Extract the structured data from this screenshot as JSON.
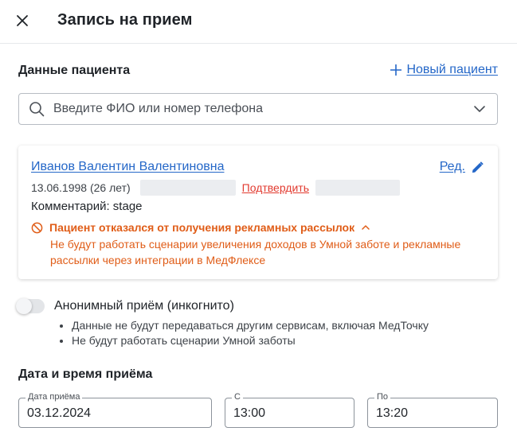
{
  "header": {
    "title": "Запись на прием"
  },
  "patient_section": {
    "title": "Данные пациента",
    "new_patient_label": "Новый пациент",
    "search_placeholder": "Введите ФИО или номер телефона"
  },
  "patient_card": {
    "name": "Иванов Валентин Валентиновна",
    "edit_label": "Ред.",
    "birth_info": "13.06.1998 (26 лет)",
    "confirm_label": "Подтвердить",
    "comment": "Комментарий: stage",
    "warning_title": "Пациент отказался от получения рекламных рассылок",
    "warning_text": "Не будут работать сценарии увеличения доходов в Умной заботе и рекламные рассылки через интеграции в МедФлексе"
  },
  "anonymous": {
    "label": "Анонимный приём (инкогнито)",
    "enabled": false,
    "notes": [
      "Данные не будут передаваться другим сервисам, включая МедТочку",
      "Не будут работать сценарии Умной заботы"
    ]
  },
  "datetime_section": {
    "title": "Дата и время приёма",
    "date_label": "Дата приёма",
    "date_value": "03.12.2024",
    "from_label": "С",
    "from_value": "13:00",
    "to_label": "По",
    "to_value": "13:20"
  },
  "colors": {
    "accent": "#2467c8",
    "warning": "#e05d18",
    "confirm": "#e23b30"
  }
}
